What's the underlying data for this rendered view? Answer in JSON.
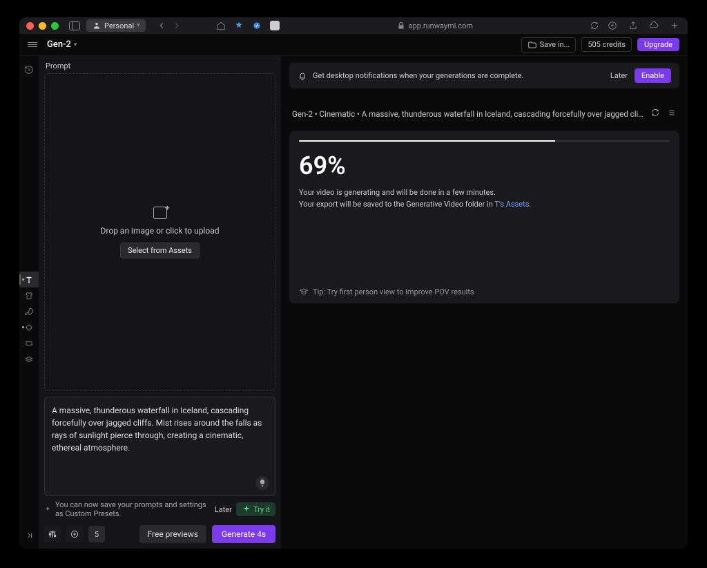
{
  "browser": {
    "personal_label": "Personal",
    "url": "app.runwayml.com"
  },
  "app": {
    "title": "Gen-2",
    "save_label": "Save in...",
    "credits_label": "505 credits",
    "upgrade_label": "Upgrade"
  },
  "prompt": {
    "section_label": "Prompt",
    "drop_text": "Drop an image or click to upload",
    "select_assets_label": "Select from Assets",
    "text_value": "A massive, thunderous waterfall in Iceland, cascading forcefully over jagged cliffs. Mist rises around the falls as rays of sunlight pierce through, creating a cinematic, ethereal atmosphere."
  },
  "preset_tip": {
    "text": "You can now save your prompts and settings as Custom Presets.",
    "later_label": "Later",
    "try_label": "Try it"
  },
  "bottom": {
    "seed_value": "5",
    "free_previews_label": "Free previews",
    "generate_label": "Generate 4s"
  },
  "notif": {
    "text": "Get desktop notifications when your generations are complete.",
    "later_label": "Later",
    "enable_label": "Enable"
  },
  "generation": {
    "header": "Gen-2 • Cinematic • A massive, thunderous waterfall in Iceland, cascading forcefully over jagged cli…",
    "percent": "69%",
    "progress_value": 69,
    "line1": "Your video is generating and will be done in a few minutes.",
    "line2_prefix": "Your export will be saved to the Generative Video folder in ",
    "line2_link": "T's Assets",
    "line2_suffix": ".",
    "tip_label": "Tip: Try first person view to improve POV results"
  }
}
